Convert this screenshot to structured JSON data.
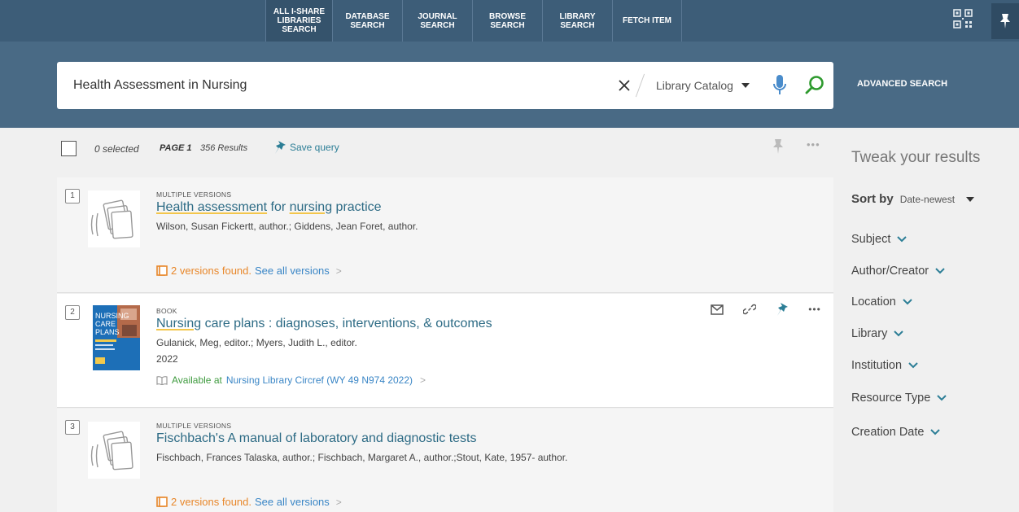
{
  "nav": {
    "links": [
      {
        "label": "ALL I-SHARE\nLIBRARIES\nSEARCH",
        "width": 82
      },
      {
        "label": "DATABASE\nSEARCH",
        "width": 86
      },
      {
        "label": "JOURNAL\nSEARCH",
        "width": 86
      },
      {
        "label": "BROWSE\nSEARCH",
        "width": 86
      },
      {
        "label": "LIBRARY\nSEARCH",
        "width": 86
      },
      {
        "label": "FETCH ITEM",
        "width": 86
      }
    ]
  },
  "search": {
    "value": "Health Assessment in Nursing",
    "scope": "Library Catalog",
    "advanced_label": "ADVANCED SEARCH"
  },
  "toolbar": {
    "selected": "0 selected",
    "page": "PAGE 1",
    "results": "356 Results",
    "save_query": "Save query"
  },
  "results": [
    {
      "num": "1",
      "type": "MULTIPLE VERSIONS",
      "title_parts": [
        {
          "text": "Health assessment",
          "hl": true
        },
        {
          "text": " for ",
          "hl": false
        },
        {
          "text": "nursing",
          "hl": true
        },
        {
          "text": " practice",
          "hl": false
        }
      ],
      "author": "Wilson, Susan Fickertt, author.; Giddens, Jean Foret, author.",
      "versions_found": "2 versions found.",
      "see_all": "See all versions"
    },
    {
      "num": "2",
      "type": "BOOK",
      "title_parts": [
        {
          "text": "Nursing",
          "hl": true
        },
        {
          "text": " care plans : diagnoses, interventions, & outcomes",
          "hl": false
        }
      ],
      "author": "Gulanick, Meg, editor.; Myers, Judith L., editor.",
      "year": "2022",
      "available_at": "Available at",
      "location": "Nursing Library  Circref (WY 49 N974 2022)"
    },
    {
      "num": "3",
      "type": "MULTIPLE VERSIONS",
      "title_parts": [
        {
          "text": "Fischbach's A manual of laboratory and diagnostic tests",
          "hl": false
        }
      ],
      "author": "Fischbach, Frances Talaska, author.; Fischbach, Margaret A., author.;Stout, Kate, 1957- author.",
      "versions_found": "2 versions found.",
      "see_all": "See all versions"
    }
  ],
  "sidebar": {
    "tweak_title": "Tweak your results",
    "sort_label": "Sort by",
    "sort_value": "Date-newest",
    "facets": [
      "Subject",
      "Author/Creator",
      "Location",
      "Library",
      "Institution",
      "Resource Type",
      "Creation Date"
    ]
  },
  "colors": {
    "nav_bg": "#3d5d78",
    "band_bg": "#496a85",
    "link": "#2d6b85",
    "highlight": "#f3c64b",
    "available": "#3f9b3f",
    "versions": "#e8872a"
  }
}
